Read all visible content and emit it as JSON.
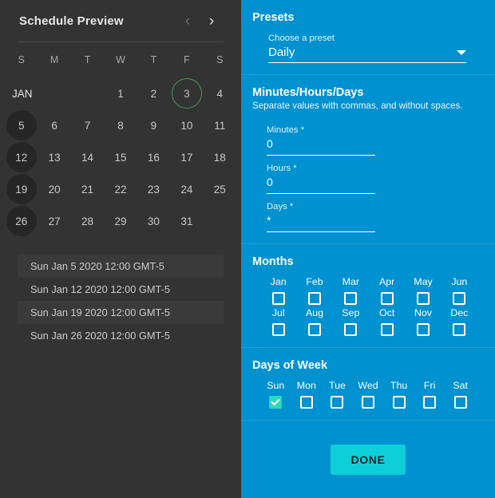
{
  "left": {
    "title": "Schedule Preview",
    "nav": {
      "prev_icon": "chevron-left-icon",
      "next_icon": "chevron-right-icon",
      "prev": "‹",
      "next": "›"
    },
    "weekdays": [
      "S",
      "M",
      "T",
      "W",
      "T",
      "F",
      "S"
    ],
    "month_label": "JAN",
    "calendar": {
      "weeks": [
        [
          {
            "label": "JAN",
            "type": "month"
          },
          {
            "label": "",
            "type": "empty"
          },
          {
            "label": "",
            "type": "empty"
          },
          {
            "label": "1",
            "type": "day"
          },
          {
            "label": "2",
            "type": "day"
          },
          {
            "label": "3",
            "type": "today"
          },
          {
            "label": "4",
            "type": "day"
          }
        ],
        [
          {
            "label": "5",
            "type": "selected"
          },
          {
            "label": "6",
            "type": "day"
          },
          {
            "label": "7",
            "type": "day"
          },
          {
            "label": "8",
            "type": "day"
          },
          {
            "label": "9",
            "type": "day"
          },
          {
            "label": "10",
            "type": "day"
          },
          {
            "label": "11",
            "type": "day"
          }
        ],
        [
          {
            "label": "12",
            "type": "selected"
          },
          {
            "label": "13",
            "type": "day"
          },
          {
            "label": "14",
            "type": "day"
          },
          {
            "label": "15",
            "type": "day"
          },
          {
            "label": "16",
            "type": "day"
          },
          {
            "label": "17",
            "type": "day"
          },
          {
            "label": "18",
            "type": "day"
          }
        ],
        [
          {
            "label": "19",
            "type": "selected"
          },
          {
            "label": "20",
            "type": "day"
          },
          {
            "label": "21",
            "type": "day"
          },
          {
            "label": "22",
            "type": "day"
          },
          {
            "label": "23",
            "type": "day"
          },
          {
            "label": "24",
            "type": "day"
          },
          {
            "label": "25",
            "type": "day"
          }
        ],
        [
          {
            "label": "26",
            "type": "selected"
          },
          {
            "label": "27",
            "type": "day"
          },
          {
            "label": "28",
            "type": "day"
          },
          {
            "label": "29",
            "type": "day"
          },
          {
            "label": "30",
            "type": "day"
          },
          {
            "label": "31",
            "type": "day"
          },
          {
            "label": "",
            "type": "empty"
          }
        ]
      ]
    },
    "schedule_list": [
      "Sun Jan 5 2020 12:00 GMT-5",
      "Sun Jan 12 2020 12:00 GMT-5",
      "Sun Jan 19 2020 12:00 GMT-5",
      "Sun Jan 26 2020 12:00 GMT-5"
    ]
  },
  "right": {
    "presets": {
      "title": "Presets",
      "field_label": "Choose a preset",
      "value": "Daily"
    },
    "mhd": {
      "title": "Minutes/Hours/Days",
      "subtitle": "Separate values with commas, and without spaces.",
      "fields": [
        {
          "label": "Minutes *",
          "value": "0"
        },
        {
          "label": "Hours *",
          "value": "0"
        },
        {
          "label": "Days *",
          "value": "*"
        }
      ]
    },
    "months": {
      "title": "Months",
      "items": [
        {
          "label": "Jan",
          "checked": false
        },
        {
          "label": "Feb",
          "checked": false
        },
        {
          "label": "Mar",
          "checked": false
        },
        {
          "label": "Apr",
          "checked": false
        },
        {
          "label": "May",
          "checked": false
        },
        {
          "label": "Jun",
          "checked": false
        },
        {
          "label": "Jul",
          "checked": false
        },
        {
          "label": "Aug",
          "checked": false
        },
        {
          "label": "Sep",
          "checked": false
        },
        {
          "label": "Oct",
          "checked": false
        },
        {
          "label": "Nov",
          "checked": false
        },
        {
          "label": "Dec",
          "checked": false
        }
      ]
    },
    "days_of_week": {
      "title": "Days of Week",
      "items": [
        {
          "label": "Sun",
          "checked": true
        },
        {
          "label": "Mon",
          "checked": false
        },
        {
          "label": "Tue",
          "checked": false
        },
        {
          "label": "Wed",
          "checked": false
        },
        {
          "label": "Thu",
          "checked": false
        },
        {
          "label": "Fri",
          "checked": false
        },
        {
          "label": "Sat",
          "checked": false
        }
      ]
    },
    "done_label": "DONE"
  },
  "colors": {
    "panel_dark": "#333333",
    "accent_blue": "#0091d0",
    "done_cyan": "#0ecfd8",
    "checked_teal": "#2bd9bb",
    "today_green": "#3f9e55"
  }
}
